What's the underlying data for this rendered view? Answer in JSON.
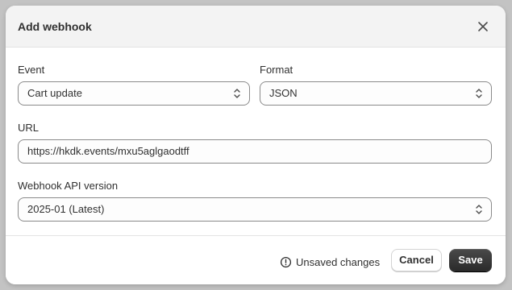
{
  "modal": {
    "title": "Add webhook"
  },
  "fields": {
    "event": {
      "label": "Event",
      "value": "Cart update"
    },
    "format": {
      "label": "Format",
      "value": "JSON"
    },
    "url": {
      "label": "URL",
      "value": "https://hkdk.events/mxu5aglgaodtff"
    },
    "api_version": {
      "label": "Webhook API version",
      "value": "2025-01 (Latest)"
    }
  },
  "footer": {
    "status_text": "Unsaved changes",
    "cancel_label": "Cancel",
    "save_label": "Save"
  },
  "icons": {
    "close": "close-icon",
    "select": "chevron-up-down-icon",
    "status": "alert-circle-icon"
  },
  "colors": {
    "primary_button": "#303030",
    "header_bg": "#f3f3f3",
    "backdrop": "#c3c3c3"
  }
}
